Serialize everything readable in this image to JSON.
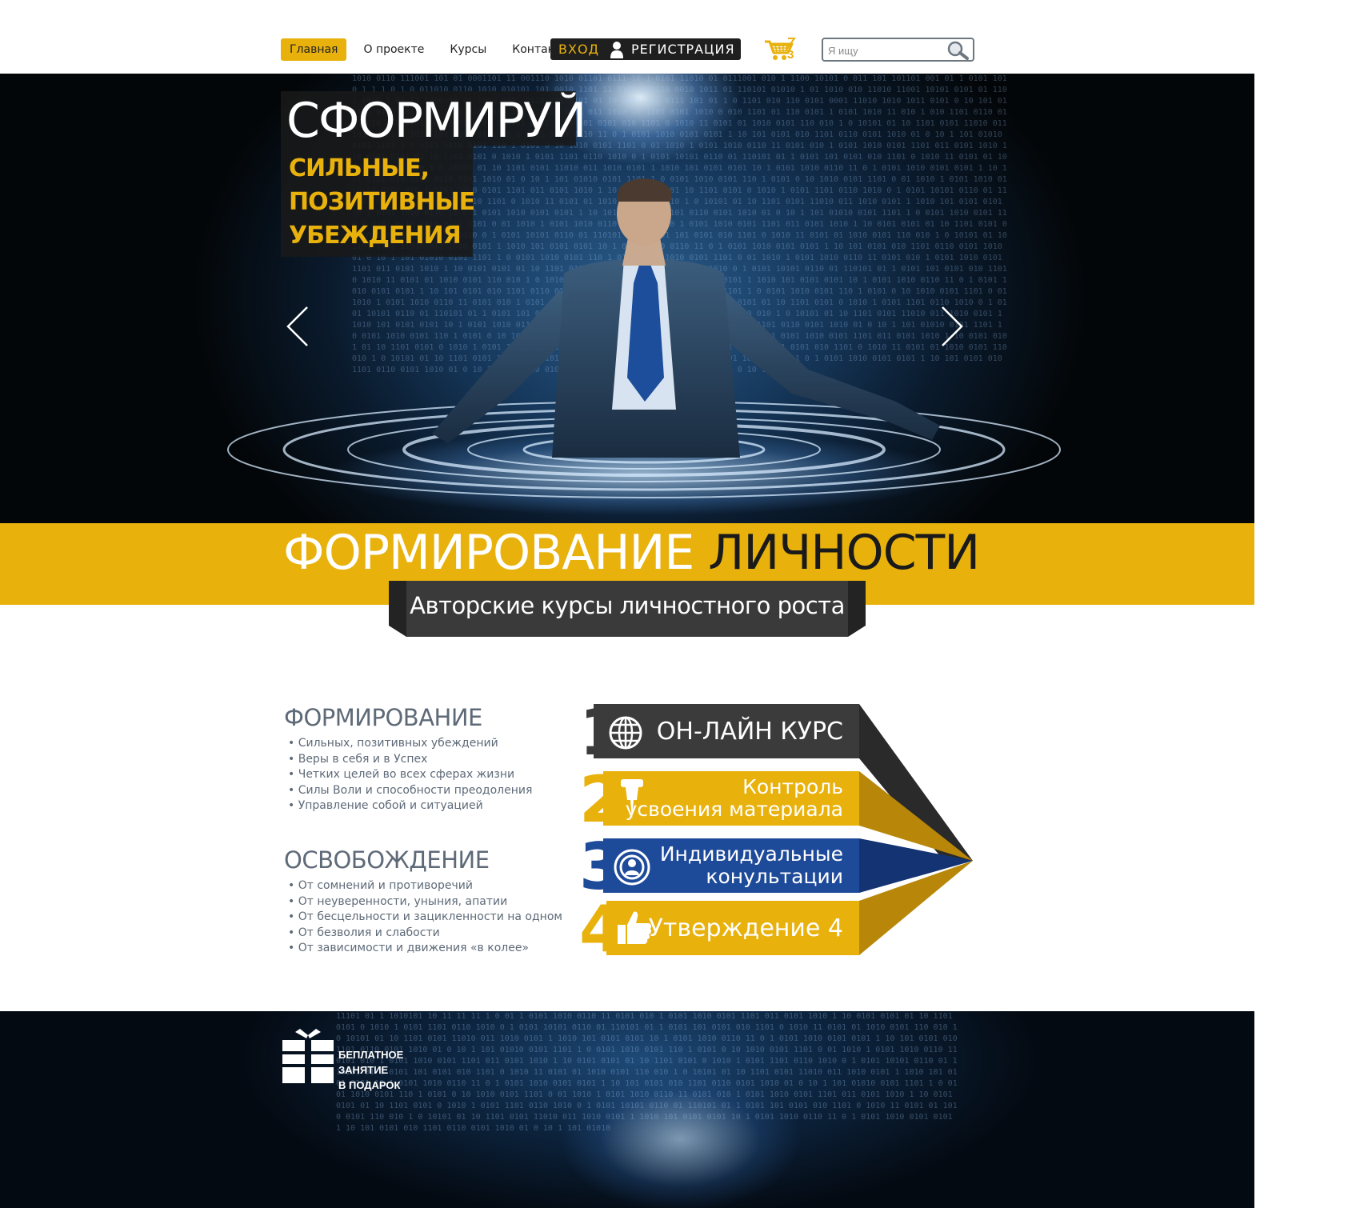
{
  "nav": {
    "items": [
      {
        "label": "Главная",
        "active": true
      },
      {
        "label": "О проекте",
        "active": false
      },
      {
        "label": "Курсы",
        "active": false
      },
      {
        "label": "Контакты",
        "active": false
      }
    ]
  },
  "auth": {
    "login_label": "ВХОД",
    "register_label": "РЕГИСТРАЦИЯ"
  },
  "cart": {
    "count": "3",
    "icon": "cart-icon"
  },
  "search": {
    "placeholder": "Я ищу",
    "value": "",
    "icon": "search-icon"
  },
  "hero": {
    "title": "СФОРМИРУЙ",
    "subtitle_lines": [
      "СИЛЬНЫЕ,",
      "ПОЗИТИВНЫЕ",
      "УБЕЖДЕНИЯ"
    ],
    "prev_icon": "chevron-left-icon",
    "next_icon": "chevron-right-icon"
  },
  "band": {
    "title_white": "ФОРМИРОВАНИЕ",
    "title_dark": "ЛИЧНОСТИ",
    "ribbon_text": "Авторские курсы личностного роста"
  },
  "lists": {
    "formation": {
      "title": "ФОРМИРОВАНИЕ",
      "items": [
        "Сильных, позитивных убеждений",
        "Веры в себя и в Успех",
        "Четких целей во всех сферах жизни",
        "Силы Воли и способности преодоления",
        "Управление собой и ситуацией"
      ]
    },
    "liberation": {
      "title": "ОСВОБОЖДЕНИЕ",
      "items": [
        "От сомнений и противоречий",
        "От неуверенности, уныния, апатии",
        "От бесцельности и зацикленности на одном",
        "От безволия и слабости",
        "От зависимости и движения «в колее»"
      ]
    }
  },
  "steps": [
    {
      "number": "1",
      "lines": [
        "ОН-ЛАЙН КУРС"
      ],
      "icon": "globe-icon",
      "color": "#3b3b3b"
    },
    {
      "number": "2",
      "lines": [
        "Контроль",
        "усвоения материала"
      ],
      "icon": "pin-icon",
      "color": "#e8b10c"
    },
    {
      "number": "3",
      "lines": [
        "Индивидуальные",
        "конультации"
      ],
      "icon": "consultant-icon",
      "color": "#1e4a9a"
    },
    {
      "number": "4",
      "lines": [
        "Утверждение 4"
      ],
      "icon": "thumbs-up-icon",
      "color": "#e8b10c"
    }
  ],
  "footer": {
    "gift_lines": [
      "БЕПЛАТНОЕ",
      "ЗАНЯТИЕ",
      "В ПОДАРОК"
    ],
    "gift_icon": "gift-icon"
  },
  "colors": {
    "accent": "#e8b10c",
    "dark": "#1f1f1f",
    "blue": "#1e4a9a",
    "text_gray": "#5e6a78"
  }
}
